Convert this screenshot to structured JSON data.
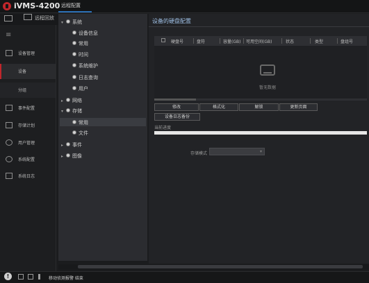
{
  "app": {
    "title": "iVMS-4200"
  },
  "tabs": {
    "playback": "远程回放",
    "remote_config": "远程配置"
  },
  "sidebar": {
    "items": [
      {
        "label": "设备管理",
        "icon": "device-management-icon"
      },
      {
        "label": "设备",
        "icon": ""
      },
      {
        "label": "分组",
        "icon": ""
      },
      {
        "label": "事件配置",
        "icon": "event-config-icon"
      },
      {
        "label": "存储计划",
        "icon": "storage-plan-icon"
      },
      {
        "label": "用户管理",
        "icon": "user-management-icon"
      },
      {
        "label": "系统配置",
        "icon": "system-config-icon"
      },
      {
        "label": "系统日志",
        "icon": "system-log-icon"
      }
    ]
  },
  "tree": {
    "nodes": [
      {
        "label": "系统",
        "expanded": true
      },
      {
        "label": "设备信息"
      },
      {
        "label": "常用"
      },
      {
        "label": "时间"
      },
      {
        "label": "系统维护"
      },
      {
        "label": "日志查询"
      },
      {
        "label": "用户"
      },
      {
        "label": "网络",
        "expanded": false
      },
      {
        "label": "存储",
        "expanded": true
      },
      {
        "label": "常用",
        "selected": true
      },
      {
        "label": "文件"
      },
      {
        "label": "事件",
        "expanded": false
      },
      {
        "label": "图像",
        "expanded": false
      }
    ]
  },
  "main": {
    "title": "设备的硬盘配置",
    "table": {
      "columns": [
        "硬盘号",
        "盘符",
        "容量(GB)",
        "可用空间(GB)",
        "状态",
        "类型",
        "盘组号"
      ],
      "rows": [],
      "empty_text": "暂无数据"
    },
    "buttons": {
      "modify": "修改",
      "format": "格式化",
      "unlock": "解锁",
      "refresh": "更新页面",
      "backup_log": "设备日志备份"
    },
    "progress": {
      "label": "当前进度",
      "value": 0
    },
    "storage_mode": {
      "label": "存储模式",
      "value": ""
    }
  },
  "statusbar": {
    "text": "移动侦测报警 结束"
  },
  "colors": {
    "accent": "#c0262b",
    "selection": "#2b6fb6",
    "title": "#9fc0e6"
  }
}
